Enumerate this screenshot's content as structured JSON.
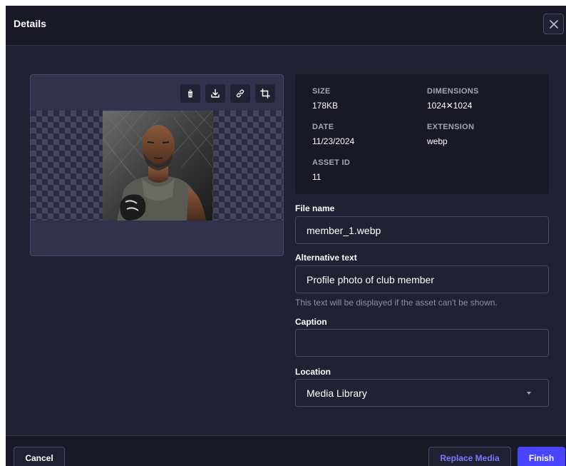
{
  "modal": {
    "title": "Details",
    "close_icon": "close-icon"
  },
  "preview": {
    "toolbar_icons": [
      "trash-icon",
      "download-icon",
      "link-icon",
      "crop-icon"
    ]
  },
  "metadata": {
    "size_label": "SIZE",
    "size_value": "178KB",
    "dimensions_label": "DIMENSIONS",
    "dimensions_value": "1024✕1024",
    "date_label": "DATE",
    "date_value": "11/23/2024",
    "extension_label": "EXTENSION",
    "extension_value": "webp",
    "asset_id_label": "ASSET ID",
    "asset_id_value": "11"
  },
  "form": {
    "file_name_label": "File name",
    "file_name_value": "member_1.webp",
    "alt_text_label": "Alternative text",
    "alt_text_value": "Profile photo of club member",
    "alt_text_hint": "This text will be displayed if the asset can't be shown.",
    "caption_label": "Caption",
    "caption_value": "",
    "location_label": "Location",
    "location_value": "Media Library"
  },
  "footer": {
    "cancel_label": "Cancel",
    "replace_label": "Replace Media",
    "finish_label": "Finish"
  },
  "colors": {
    "primary": "#4945ff",
    "surface": "#212134",
    "header": "#181826"
  }
}
